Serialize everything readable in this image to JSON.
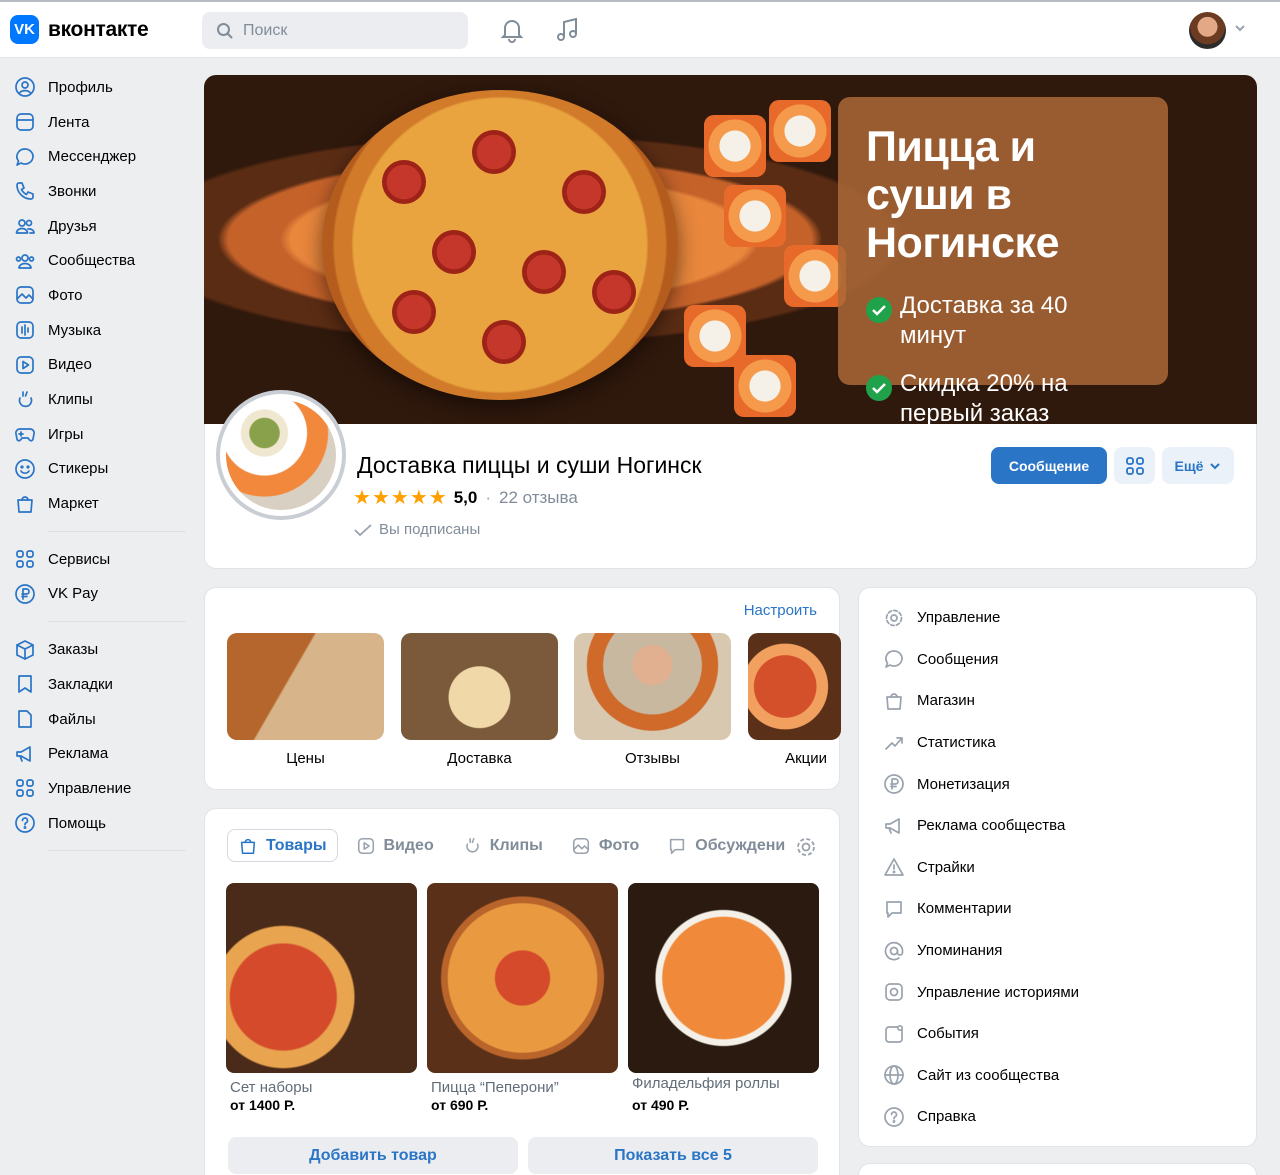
{
  "topbar": {
    "logo_mark": "VK",
    "logo_text": "вконтакте",
    "search_placeholder": "Поиск"
  },
  "sidebar": {
    "group1": [
      {
        "label": "Профиль",
        "icon": "profile-icon"
      },
      {
        "label": "Лента",
        "icon": "feed-icon"
      },
      {
        "label": "Мессенджер",
        "icon": "messenger-icon"
      },
      {
        "label": "Звонки",
        "icon": "phone-icon"
      },
      {
        "label": "Друзья",
        "icon": "friends-icon"
      },
      {
        "label": "Сообщества",
        "icon": "communities-icon"
      },
      {
        "label": "Фото",
        "icon": "photo-icon"
      },
      {
        "label": "Музыка",
        "icon": "music-icon"
      },
      {
        "label": "Видео",
        "icon": "video-icon"
      },
      {
        "label": "Клипы",
        "icon": "clips-icon"
      },
      {
        "label": "Игры",
        "icon": "games-icon"
      },
      {
        "label": "Стикеры",
        "icon": "stickers-icon"
      },
      {
        "label": "Маркет",
        "icon": "market-icon"
      }
    ],
    "group2": [
      {
        "label": "Сервисы",
        "icon": "services-icon"
      },
      {
        "label": "VK Pay",
        "icon": "vkpay-icon"
      }
    ],
    "group3": [
      {
        "label": "Заказы",
        "icon": "orders-icon"
      },
      {
        "label": "Закладки",
        "icon": "bookmarks-icon"
      },
      {
        "label": "Файлы",
        "icon": "files-icon"
      },
      {
        "label": "Реклама",
        "icon": "ads-icon"
      },
      {
        "label": "Управление",
        "icon": "manage-icon"
      },
      {
        "label": "Помощь",
        "icon": "help-icon"
      }
    ]
  },
  "cover": {
    "title": "Пицца и суши в Ногинске",
    "point1": "Доставка за 40 минут",
    "point2": "Скидка 20% на первый заказ"
  },
  "group": {
    "name": "Доставка пиццы и суши Ногинск",
    "rating": "5,0",
    "rating_stars": 5,
    "reviews": "22 отзыва",
    "subscribed": "Вы подписаны",
    "message_button": "Сообщение",
    "more_button": "Ещё"
  },
  "tiles": {
    "configure": "Настроить",
    "items": [
      {
        "label": "Цены"
      },
      {
        "label": "Доставка"
      },
      {
        "label": "Отзывы"
      },
      {
        "label": "Акции"
      }
    ]
  },
  "goods": {
    "tabs": [
      {
        "label": "Товары",
        "icon": "bag-icon"
      },
      {
        "label": "Видео",
        "icon": "video-icon"
      },
      {
        "label": "Клипы",
        "icon": "clips-icon"
      },
      {
        "label": "Фото",
        "icon": "photo-icon"
      },
      {
        "label": "Обсуждени",
        "icon": "discussion-icon"
      }
    ],
    "items": [
      {
        "name": "Сет наборы",
        "price": "от 1400 Р."
      },
      {
        "name": "Пицца “Пеперони”",
        "price": "от 690 Р."
      },
      {
        "name": "Филадельфия роллы",
        "price": "от 490 Р."
      }
    ],
    "add_button": "Добавить товар",
    "show_all_button": "Показать все 5"
  },
  "manage_menu": [
    {
      "label": "Управление",
      "icon": "gear-icon"
    },
    {
      "label": "Сообщения",
      "icon": "message-icon"
    },
    {
      "label": "Магазин",
      "icon": "shop-icon"
    },
    {
      "label": "Статистика",
      "icon": "stats-icon"
    },
    {
      "label": "Монетизация",
      "icon": "ruble-icon"
    },
    {
      "label": "Реклама сообщества",
      "icon": "megaphone-icon"
    },
    {
      "label": "Страйки",
      "icon": "warning-icon"
    },
    {
      "label": "Комментарии",
      "icon": "comment-icon"
    },
    {
      "label": "Упоминания",
      "icon": "at-icon"
    },
    {
      "label": "Управление историями",
      "icon": "story-icon"
    },
    {
      "label": "События",
      "icon": "event-icon"
    },
    {
      "label": "Сайт из сообщества",
      "icon": "globe-icon"
    },
    {
      "label": "Справка",
      "icon": "help-icon"
    }
  ],
  "colors": {
    "accent": "#2a75c6",
    "brand": "#0077ff",
    "background": "#edeef0"
  }
}
